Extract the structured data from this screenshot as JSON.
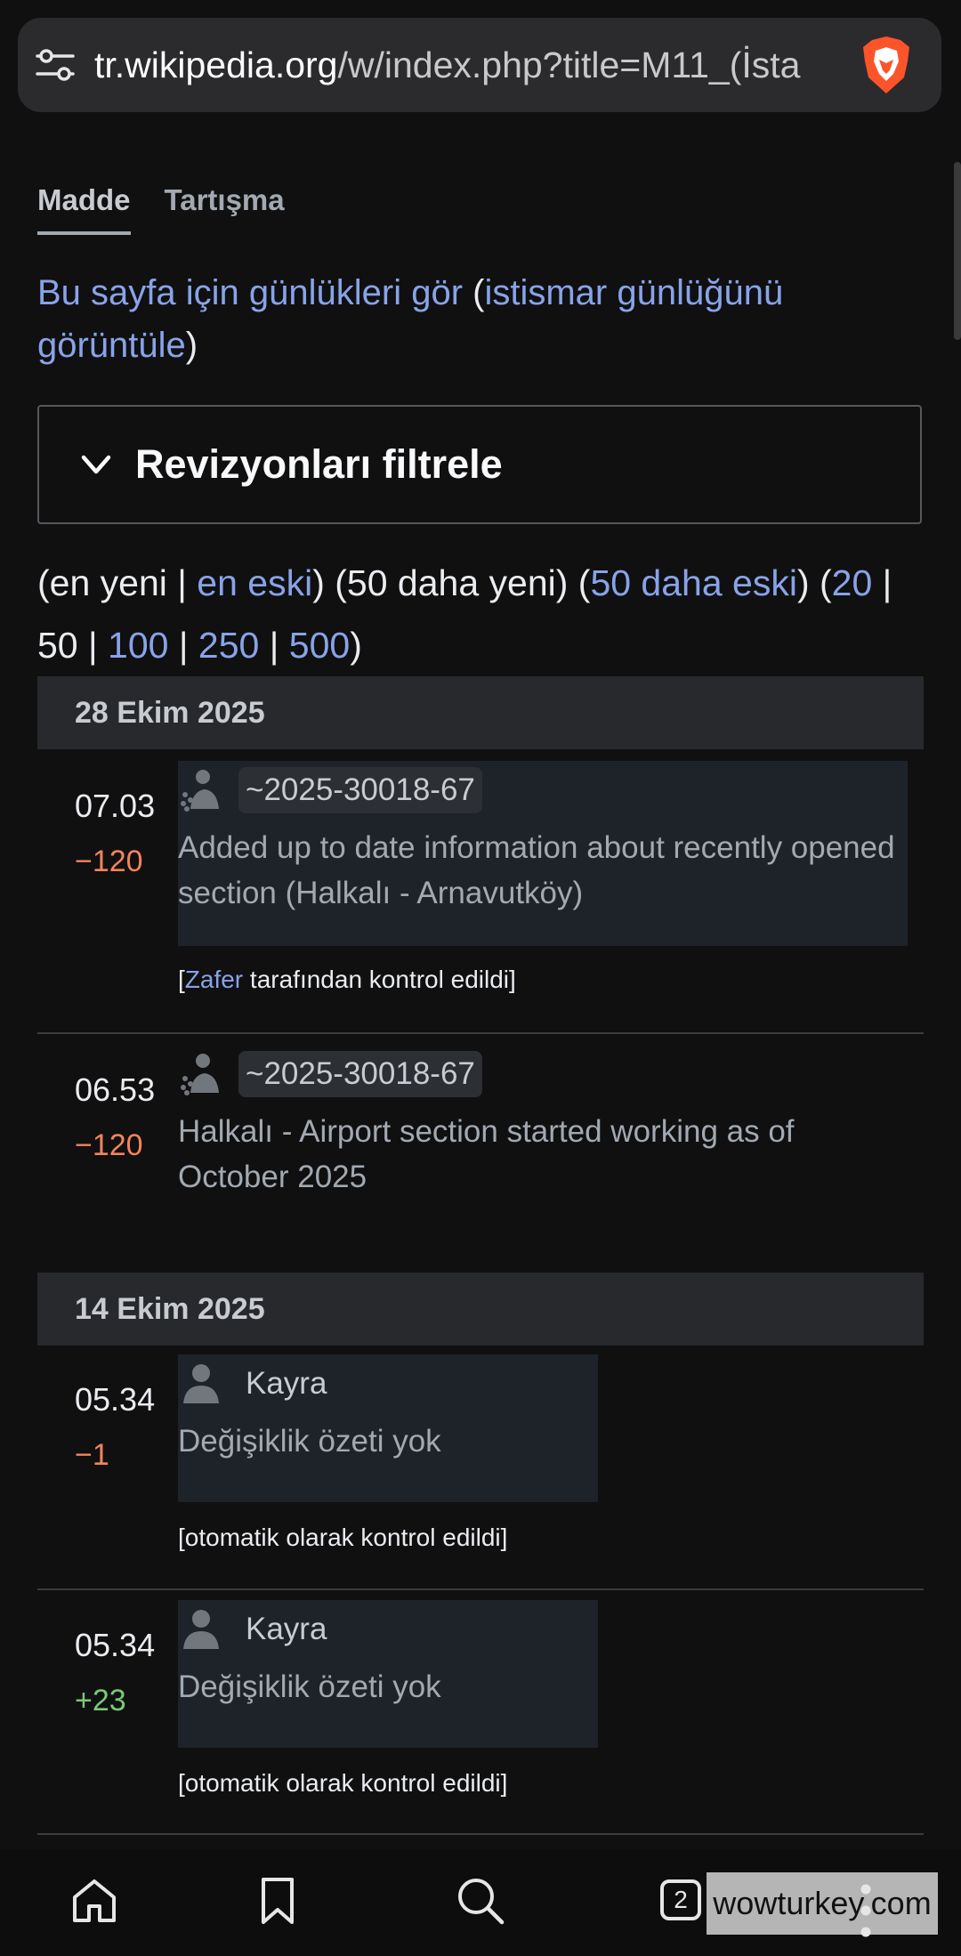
{
  "browser": {
    "url_host": "tr.wikipedia.org",
    "url_path": "/w/index.php?title=M11_(İsta",
    "tab_count": "2",
    "watermark": "wowturkey.com"
  },
  "tabs": [
    {
      "label": "Madde",
      "active": true
    },
    {
      "label": "Tartışma",
      "active": false
    }
  ],
  "logs_line": {
    "view_logs": "Bu sayfa için günlükleri gör",
    "open_paren": " (",
    "abuse_log": "istismar günlüğünü görüntüle",
    "close_paren": ")"
  },
  "filter": {
    "label": "Revizyonları filtrele"
  },
  "pager": {
    "p1": "(en yeni | ",
    "oldest": "en eski",
    "p2": ") (50 daha yeni) (",
    "older50": "50 daha eski",
    "p3": ") (",
    "n20": "20",
    "p4": " | 50 | ",
    "n100": "100",
    "sep1": " | ",
    "n250": "250",
    "sep2": " | ",
    "n500": "500",
    "p5": ")"
  },
  "dates": [
    "28 Ekim 2025",
    "14 Ekim 2025"
  ],
  "revisions": [
    {
      "time": "07.03",
      "size": "−120",
      "user": "~2025-30018-67",
      "summary": "Added up to date information about recently opened section (Halkalı - Arnavutköy)",
      "patrol_open": "[",
      "patrol_user": "Zafer",
      "patrol_text": " tarafından kontrol edildi]"
    },
    {
      "time": "06.53",
      "size": "−120",
      "user": "~2025-30018-67",
      "summary": "Halkalı - Airport section started working as of October 2025"
    },
    {
      "time": "05.34",
      "size": "−1",
      "user": "Kayra",
      "summary": "Değişiklik özeti yok",
      "patrol": "[otomatik olarak kontrol edildi]"
    },
    {
      "time": "05.34",
      "size": "+23",
      "user": "Kayra",
      "summary": "Değişiklik özeti yok",
      "patrol": "[otomatik olarak kontrol edildi]"
    }
  ],
  "colors": {
    "background": "#101011",
    "link": "#88a3e8",
    "negative": "#f4835c",
    "positive": "#7ac977"
  },
  "icons": [
    "tune-icon",
    "brave-lion-icon",
    "chevron-down-icon",
    "temp-user-icon",
    "user-icon",
    "home-icon",
    "bookmark-icon",
    "search-icon",
    "tabs-icon",
    "menu-dots-icon"
  ]
}
